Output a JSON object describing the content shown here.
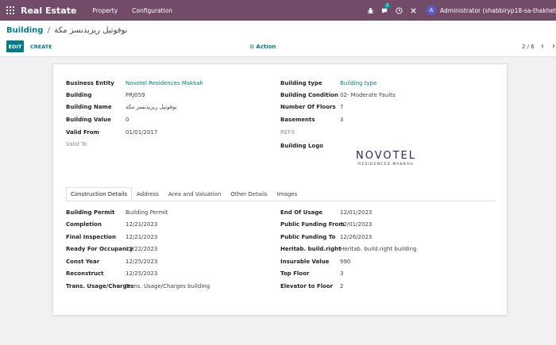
{
  "navbar": {
    "brand": "Real Estate",
    "menu": [
      "Property",
      "Configuration"
    ],
    "notification_count": "2",
    "user_initial": "A",
    "user_name": "Administrator (shabbiryp18-sa-thakhet"
  },
  "breadcrumb": {
    "parent": "Building",
    "separator": "/",
    "current": "نوفوتيل ريزيدنسز مكة"
  },
  "toolbar": {
    "edit_label": "EDIT",
    "create_label": "CREATE",
    "action_label": "Action",
    "pager": "2 / 6"
  },
  "form": {
    "left": [
      {
        "label": "Business Entity",
        "value": "Novotel Residences Makkah",
        "link": true
      },
      {
        "label": "Building",
        "value": "PRJ059",
        "link": false
      },
      {
        "label": "Building Name",
        "value": "نوفوتيل ريزيدنسز مكة",
        "link": false
      },
      {
        "label": "Building Value",
        "value": "0",
        "link": false
      },
      {
        "label": "Valid From",
        "value": "01/01/2017",
        "link": false
      },
      {
        "label": "Valid To",
        "value": "",
        "link": false
      }
    ],
    "right": [
      {
        "label": "Building type",
        "value": "Building type",
        "link": true
      },
      {
        "label": "Building Condition",
        "value": "02- Moderate Faults",
        "link": false
      },
      {
        "label": "Number Of Floors",
        "value": "7",
        "link": false
      },
      {
        "label": "Basements",
        "value": "3",
        "link": false
      },
      {
        "label": "REFX",
        "value": "",
        "link": false
      },
      {
        "label": "Building Logo",
        "value": "",
        "link": false
      }
    ],
    "logo": {
      "main": "NOVOTEL",
      "sub": "RESIDENCES MAKKAH"
    }
  },
  "tabs": [
    "Construction Details",
    "Address",
    "Area and Valuation",
    "Other Details",
    "Images"
  ],
  "construction": {
    "left": [
      {
        "label": "Building Permit",
        "value": "Building Permit"
      },
      {
        "label": "Completion",
        "value": "12/21/2023"
      },
      {
        "label": "Final Inspection",
        "value": "12/21/2023"
      },
      {
        "label": "Ready For Occupancy",
        "value": "12/22/2023"
      },
      {
        "label": "Const Year",
        "value": "12/25/2023"
      },
      {
        "label": "Reconstruct",
        "value": "12/25/2023"
      },
      {
        "label": "Trans. Usage/Charges",
        "value": "Trans. Usage/Charges building"
      }
    ],
    "right": [
      {
        "label": "End Of Usage",
        "value": "12/01/2023"
      },
      {
        "label": "Public Funding From",
        "value": "12/01/2023"
      },
      {
        "label": "Public Funding To",
        "value": "12/26/2023"
      },
      {
        "label": "Heritab. build.right",
        "value": "Heritab. build.right building"
      },
      {
        "label": "Insurable Value",
        "value": "990"
      },
      {
        "label": "Top Floor",
        "value": "3"
      },
      {
        "label": "Elevator to Floor",
        "value": "2"
      }
    ]
  },
  "colors": {
    "navbar": "#714b67",
    "primary": "#017e84",
    "background": "#f1f1f4"
  }
}
